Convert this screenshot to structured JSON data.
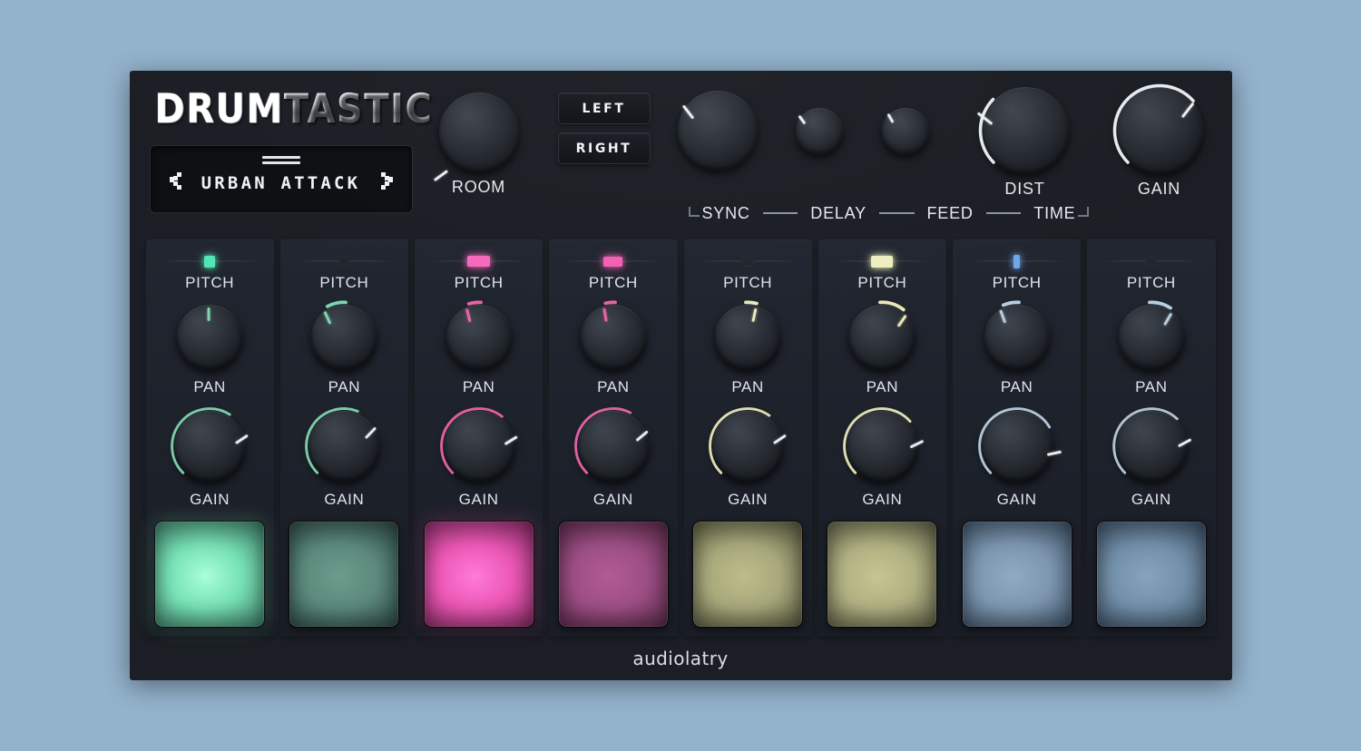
{
  "app": {
    "logo_primary": "DRUM",
    "logo_secondary": "TASTIC",
    "footer_brand": "audiolatry"
  },
  "preset": {
    "name": "URBAN ATTACK",
    "prev_label": "‹",
    "next_label": "›"
  },
  "master": {
    "room": {
      "label": "ROOM",
      "angle": -126,
      "arc": 0,
      "size": 88
    },
    "sync": {
      "group_label": "SYNC",
      "buttons": [
        {
          "label": "LEFT",
          "active": false
        },
        {
          "label": "RIGHT",
          "active": false
        }
      ]
    },
    "delay": {
      "label": "DELAY",
      "angle": -38,
      "arc": 0,
      "size": 88
    },
    "feed": {
      "label": "FEED",
      "angle": -36,
      "arc": 0,
      "size": 52
    },
    "time": {
      "label": "TIME",
      "angle": -30,
      "arc": 0,
      "size": 52
    },
    "dist": {
      "label": "DIST",
      "angle": -52,
      "arc": 33,
      "size": 96,
      "arc_color": "#f2f5f9"
    },
    "gain": {
      "label": "GAIN",
      "angle": 38,
      "arc": 68,
      "size": 96,
      "arc_color": "#f2f5f9"
    }
  },
  "labels": {
    "pitch": "PITCH",
    "pan": "PAN",
    "gain": "GAIN"
  },
  "channels": [
    {
      "index": 1,
      "accent": "#7fd4b0",
      "pitch": {
        "value": 50,
        "handle_w": 12,
        "handle_h": 13,
        "lit": true,
        "color": "#4fe8b4"
      },
      "pan": {
        "angle": 0,
        "arc": 0
      },
      "gain": {
        "angle": 56,
        "arc": 62,
        "color": "#7fd4b0"
      },
      "pad": {
        "core": "#a8ffd9",
        "mid": "#76e0b4",
        "edge": "#3f7f6a",
        "lit": true
      }
    },
    {
      "index": 2,
      "accent": "#6fae95",
      "pitch": {
        "value": 50,
        "handle_w": 12,
        "handle_h": 12,
        "lit": false,
        "color": "#20262e"
      },
      "pan": {
        "angle": -25,
        "arc": 12,
        "color": "#7fd4b0"
      },
      "gain": {
        "angle": 44,
        "arc": 58,
        "color": "#7fd4b0"
      },
      "pad": {
        "core": "#6a9c8c",
        "mid": "#5c8a7c",
        "edge": "#2f4a43",
        "lit": false
      }
    },
    {
      "index": 3,
      "accent": "#e864a8",
      "pitch": {
        "value": 50,
        "handle_w": 25,
        "handle_h": 12,
        "lit": true,
        "color": "#f669bd"
      },
      "pan": {
        "angle": -14,
        "arc": 8,
        "color": "#e864a8"
      },
      "gain": {
        "angle": 58,
        "arc": 64,
        "color": "#e864a8"
      },
      "pad": {
        "core": "#ff7ada",
        "mid": "#ec58b5",
        "edge": "#8a2c67",
        "lit": true
      }
    },
    {
      "index": 4,
      "accent": "#c4558f",
      "pitch": {
        "value": 50,
        "handle_w": 21,
        "handle_h": 11,
        "lit": true,
        "color": "#f35fb4"
      },
      "pan": {
        "angle": -10,
        "arc": 6,
        "color": "#e864a8"
      },
      "gain": {
        "angle": 50,
        "arc": 60,
        "color": "#e864a8"
      },
      "pad": {
        "core": "#b25b96",
        "mid": "#9d4f84",
        "edge": "#5b2b4b",
        "lit": false
      }
    },
    {
      "index": 5,
      "accent": "#e0e0b0",
      "pitch": {
        "value": 50,
        "handle_w": 14,
        "handle_h": 11,
        "lit": false,
        "color": "#23262c"
      },
      "pan": {
        "angle": 12,
        "arc": 7,
        "color": "#e8e8b8"
      },
      "gain": {
        "angle": 56,
        "arc": 63,
        "color": "#e8e8b8"
      },
      "pad": {
        "core": "#bcbc8a",
        "mid": "#a8a87c",
        "edge": "#5c5c42",
        "lit": false
      }
    },
    {
      "index": 6,
      "accent": "#e8e8b8",
      "pitch": {
        "value": 50,
        "handle_w": 24,
        "handle_h": 13,
        "lit": true,
        "color": "#eeeebe"
      },
      "pan": {
        "angle": 35,
        "arc": 18,
        "color": "#e8e8b8"
      },
      "gain": {
        "angle": 64,
        "arc": 68,
        "color": "#e8e8b8"
      },
      "pad": {
        "core": "#c6c690",
        "mid": "#b0b082",
        "edge": "#626248",
        "lit": false
      }
    },
    {
      "index": 7,
      "accent": "#b8cee0",
      "pitch": {
        "value": 50,
        "handle_w": 7,
        "handle_h": 15,
        "lit": true,
        "color": "#6ea8e6"
      },
      "pan": {
        "angle": -20,
        "arc": 10,
        "color": "#b8cee0"
      },
      "gain": {
        "angle": 78,
        "arc": 72,
        "color": "#b8cee0"
      },
      "pad": {
        "core": "#90aac4",
        "mid": "#7d97b0",
        "edge": "#42566b",
        "lit": false
      }
    },
    {
      "index": 8,
      "accent": "#a6c0d6",
      "pitch": {
        "value": 50,
        "handle_w": 13,
        "handle_h": 11,
        "lit": false,
        "color": "#212630"
      },
      "pan": {
        "angle": 30,
        "arc": 15,
        "color": "#b8cee0"
      },
      "gain": {
        "angle": 62,
        "arc": 66,
        "color": "#b8cee0"
      },
      "pad": {
        "core": "#87a2bd",
        "mid": "#7390aa",
        "edge": "#3d5165",
        "lit": false
      }
    }
  ]
}
